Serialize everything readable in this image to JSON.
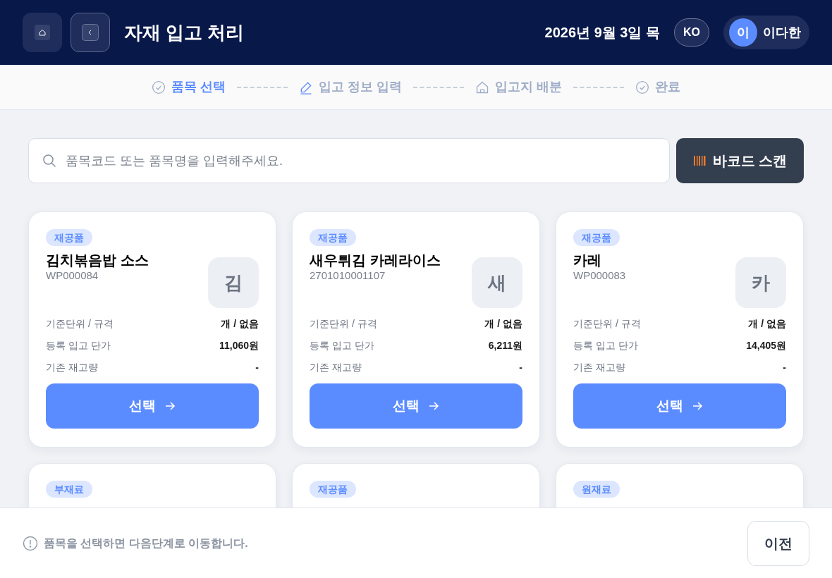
{
  "header": {
    "title": "자재 입고 처리",
    "date": "2026년 9월 3일 목",
    "language": "KO",
    "user": {
      "initial": "이",
      "name": "이다한"
    }
  },
  "steps": [
    {
      "label": "품목 선택",
      "kind": "check",
      "selected": true
    },
    {
      "label": "입고 정보 입력",
      "kind": "edit",
      "selected": false
    },
    {
      "label": "입고지 배분",
      "kind": "home",
      "selected": false
    },
    {
      "label": "완료",
      "kind": "check",
      "selected": false
    }
  ],
  "search": {
    "placeholder": "품목코드 또는 품목명을 입력해주세요."
  },
  "barcode_button": "바코드 스캔",
  "items": [
    {
      "tag": "재공품",
      "name": "김치볶음밥 소스",
      "code": "WP000084",
      "initial": "김",
      "rows": [
        {
          "label": "기준단위 / 규격",
          "value": "개 / 없음"
        },
        {
          "label": "등록 입고 단가",
          "value": "11,060원"
        },
        {
          "label": "기존 재고량",
          "value": "-"
        }
      ],
      "button": "선택"
    },
    {
      "tag": "재공품",
      "name": "새우튀김 카레라이스",
      "code": "2701010001107",
      "initial": "새",
      "rows": [
        {
          "label": "기준단위 / 규격",
          "value": "개 / 없음"
        },
        {
          "label": "등록 입고 단가",
          "value": "6,211원"
        },
        {
          "label": "기존 재고량",
          "value": "-"
        }
      ],
      "button": "선택"
    },
    {
      "tag": "재공품",
      "name": "카레",
      "code": "WP000083",
      "initial": "카",
      "rows": [
        {
          "label": "기준단위 / 규격",
          "value": "개 / 없음"
        },
        {
          "label": "등록 입고 단가",
          "value": "14,405원"
        },
        {
          "label": "기존 재고량",
          "value": "-"
        }
      ],
      "button": "선택"
    },
    {
      "tag": "부재료"
    },
    {
      "tag": "재공품"
    },
    {
      "tag": "원재료"
    }
  ],
  "footer": {
    "hint": "품목을 선택하면 다음단계로 이동합니다.",
    "prev_button": "이전"
  }
}
